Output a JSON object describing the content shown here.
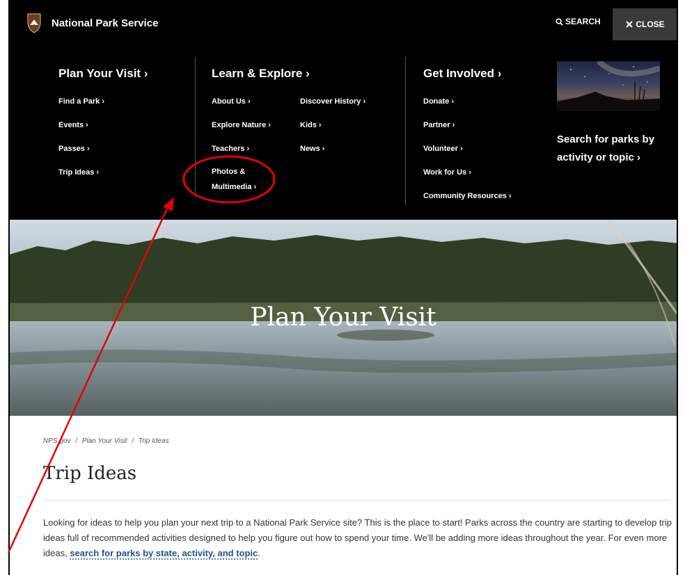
{
  "header": {
    "brand": "National Park Service",
    "search_label": "SEARCH",
    "close_label": "CLOSE"
  },
  "menu": {
    "plan": {
      "heading": "Plan Your Visit ›",
      "items": [
        "Find a Park ›",
        "Events ›",
        "Passes ›",
        "Trip Ideas ›"
      ]
    },
    "learn": {
      "heading": "Learn & Explore ›",
      "col1": [
        "About Us ›",
        "Explore Nature ›",
        "Teachers ›",
        "Photos &",
        "Multimedia ›"
      ],
      "col2": [
        "Discover History ›",
        "Kids ›",
        "News ›"
      ]
    },
    "involved": {
      "heading": "Get Involved ›",
      "items": [
        "Donate ›",
        "Partner ›",
        "Volunteer ›",
        "Work for Us ›",
        "Community Resources ›"
      ]
    },
    "feature": {
      "line1": "Search for parks by",
      "line2": "activity or topic ›"
    }
  },
  "hero": {
    "title": "Plan Your Visit"
  },
  "breadcrumb": {
    "home": "NPS.gov",
    "sep": "/",
    "parent": "Plan Your Visit",
    "current": "Trip Ideas"
  },
  "page": {
    "title": "Trip Ideas",
    "body": "Looking for ideas to help you plan your next trip to a National Park Service site? This is the place to start! Parks across the country are starting to develop trip ideas full of recommended activities designed to help you figure out how to spend your time. We'll be adding more ideas throughout the year. For even more ideas, ",
    "link": "search for parks by state, activity, and topic",
    "body_end": "."
  },
  "colors": {
    "nav_bg": "#000000",
    "close_bg": "#3a3a3a",
    "link_blue": "#20538f",
    "annotation": "#e60000"
  }
}
